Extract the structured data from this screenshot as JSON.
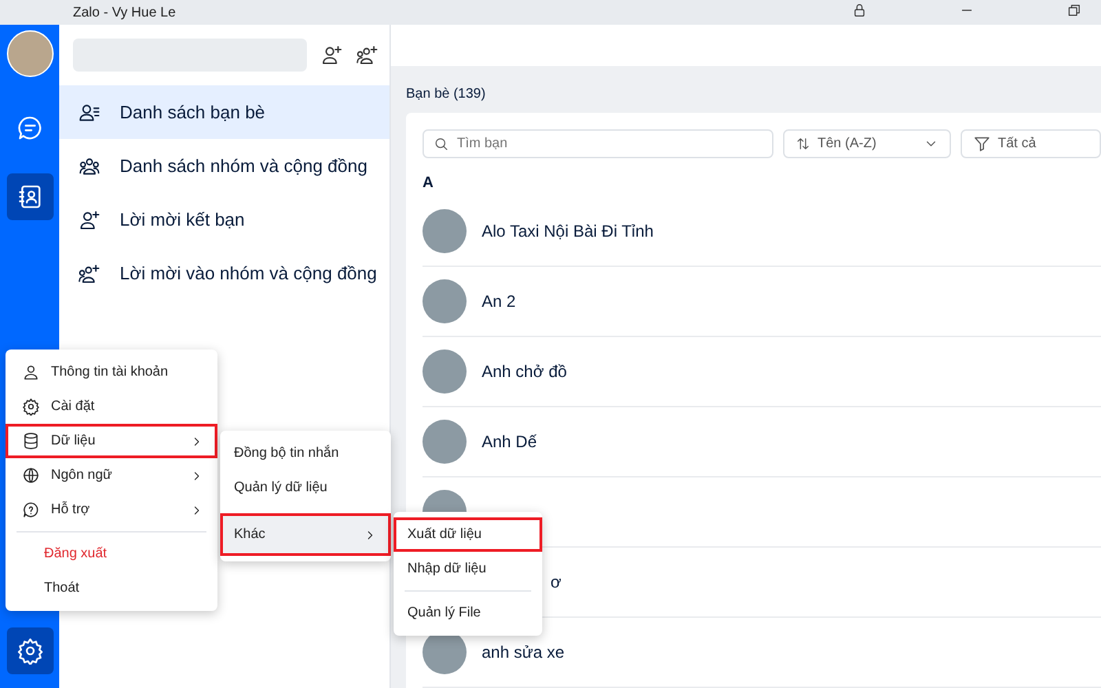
{
  "window": {
    "title": "Zalo - Vy Hue Le"
  },
  "nav": {
    "items": [
      {
        "kind": "chat",
        "selected": false
      },
      {
        "kind": "contacts",
        "selected": true
      }
    ]
  },
  "sidebar": {
    "items": [
      {
        "kind": "friends",
        "label": "Danh sách bạn bè",
        "selected": true
      },
      {
        "kind": "groups",
        "label": "Danh sách nhóm và cộng đồng",
        "selected": false
      },
      {
        "kind": "friend-request",
        "label": "Lời mời kết bạn",
        "selected": false
      },
      {
        "kind": "group-invite",
        "label": "Lời mời vào nhóm và cộng đồng",
        "selected": false
      }
    ]
  },
  "friends": {
    "heading": "Bạn bè (139)",
    "search": {
      "placeholder": "Tìm bạn"
    },
    "sort": {
      "value": "Tên (A-Z)"
    },
    "filter": {
      "value": "Tất cả"
    },
    "letter": "A",
    "rows": [
      {
        "kind": "named",
        "name": "Alo Taxi Nội Bài Đi Tỉnh"
      },
      {
        "kind": "named",
        "name": "An 2"
      },
      {
        "kind": "named",
        "name": "Anh chở đồ"
      },
      {
        "kind": "named",
        "name": "Anh Dế"
      },
      {
        "kind": "covered"
      },
      {
        "kind": "partial",
        "name": "ơ"
      },
      {
        "kind": "named",
        "name": "anh sửa xe"
      }
    ]
  },
  "menu": {
    "items": [
      {
        "kind": "account",
        "label": "Thông tin tài khoản",
        "submenu": false,
        "highlighted": false
      },
      {
        "kind": "settings",
        "label": "Cài đặt",
        "submenu": false,
        "highlighted": false
      },
      {
        "kind": "data",
        "label": "Dữ liệu",
        "submenu": true,
        "highlighted": true
      },
      {
        "kind": "language",
        "label": "Ngôn ngữ",
        "submenu": true,
        "highlighted": false
      },
      {
        "kind": "help",
        "label": "Hỗ trợ",
        "submenu": true,
        "highlighted": false
      },
      {
        "kind": "logout",
        "label": "Đăng xuất",
        "submenu": false,
        "highlighted": false
      },
      {
        "kind": "quit",
        "label": "Thoát",
        "submenu": false,
        "highlighted": false
      }
    ]
  },
  "data_submenu": {
    "items": [
      {
        "label": "Đồng bộ tin nhắn",
        "submenu": false,
        "highlighted": false,
        "selected": false
      },
      {
        "label": "Quản lý dữ liệu",
        "submenu": false,
        "highlighted": false,
        "selected": false
      },
      {
        "label": "Khác",
        "submenu": true,
        "highlighted": true,
        "selected": true
      }
    ]
  },
  "other_submenu": {
    "items": [
      {
        "label": "Xuất dữ liệu",
        "highlighted": true
      },
      {
        "label": "Nhập dữ liệu",
        "highlighted": false
      },
      {
        "label": "Quản lý File",
        "highlighted": false
      }
    ]
  }
}
